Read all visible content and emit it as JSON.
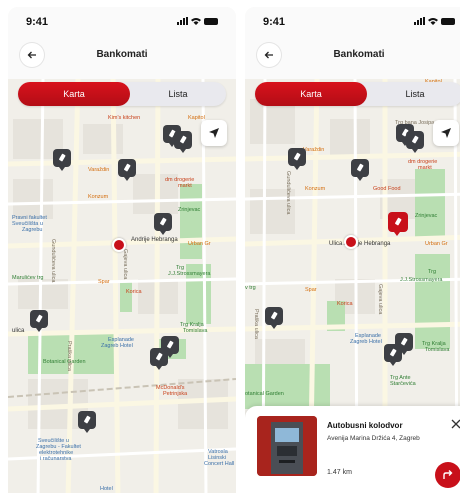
{
  "status": {
    "time": "9:41"
  },
  "header": {
    "title": "Bankomati",
    "back_icon": "arrow-left-icon"
  },
  "segments": {
    "map_label": "Karta",
    "list_label": "Lista"
  },
  "icons": {
    "atm": "card-in-slot-icon",
    "locate": "navigation-arrow-icon",
    "close": "close-icon",
    "directions": "turn-right-arrow-icon"
  },
  "colors": {
    "brand_red": "#c8101a",
    "pin_dark": "#3d3f44"
  },
  "map_a": {
    "labels": {
      "kapitol": "Kapitol",
      "kim": "Kim's kitchen",
      "varazdin": "Varaždin",
      "dm": "dm drogerie",
      "markt": "markt",
      "konzum": "Konzum",
      "pravni": "Pravni fakultet",
      "sveucilista": "Sveučilišta u",
      "zagrebu": "Zagrebu",
      "zrinjevac": "Zrinjevac",
      "andrije": "Andrije Hebranga",
      "urban": "Urban Gr",
      "marulic": "Marulićev trg",
      "spar": "Spar",
      "trg_jj": "Trg",
      "jj": "J.J.Strossmayera",
      "korica": "Korica",
      "trg_kralja": "Trg Kralja",
      "tomislava": "Tomislava",
      "esplanade": "Esplanade",
      "esplanade2": "Zagreb Hotel",
      "botanical": "Botanical Garden",
      "mcd": "McDonald's",
      "mcd2": "Petrinjska",
      "sveuciliste": "Sveučilište u",
      "fer1": "Zagrebu - Fakultet",
      "fer2": "elektrotehnike",
      "fer3": "i računarstva",
      "vatrosla": "Vatrosla",
      "lisinski": "Lisinski",
      "concert": "Concert Hall",
      "hotel": "Hotel",
      "ulica": "ulica",
      "gunduliceva": "Gundulićeva ulica",
      "praska": "Praška ulica",
      "gajeva": "Gajeva ulica"
    }
  },
  "map_b": {
    "labels": {
      "kapitol": "Kapitol",
      "trg_bana": "Trg bana Josipa",
      "varazdin": "Varaždin",
      "dm": "dm drogerie",
      "markt": "markt",
      "konzum": "Konzum",
      "good_food": "Good Food",
      "zrinjevac": "Zrinjevac",
      "gunduliceva": "Gundulićeva ulica",
      "ulica_hebranga": "Ulica Andrije Hebranga",
      "urban": "Urban Gr",
      "trg_left": "v trg",
      "spar": "Spar",
      "trg_jj": "Trg",
      "jj": "J.J.Strossmayera",
      "korica": "Korica",
      "trg_kralja": "Trg Kralja",
      "tomislava": "Tomislava",
      "esplanade": "Esplanade",
      "esplanade2": "Zagreb Hotel",
      "trg_ante": "Trg Ante",
      "starcevica": "Starčevića",
      "botanical": "otanical Garden",
      "praska": "Praška ulica",
      "gajeva": "Gajeva ulica"
    }
  },
  "detail": {
    "name": "Autobusni kolodvor",
    "address": "Avenija Marina Držića 4, Zagreb",
    "distance": "1.47 km"
  }
}
